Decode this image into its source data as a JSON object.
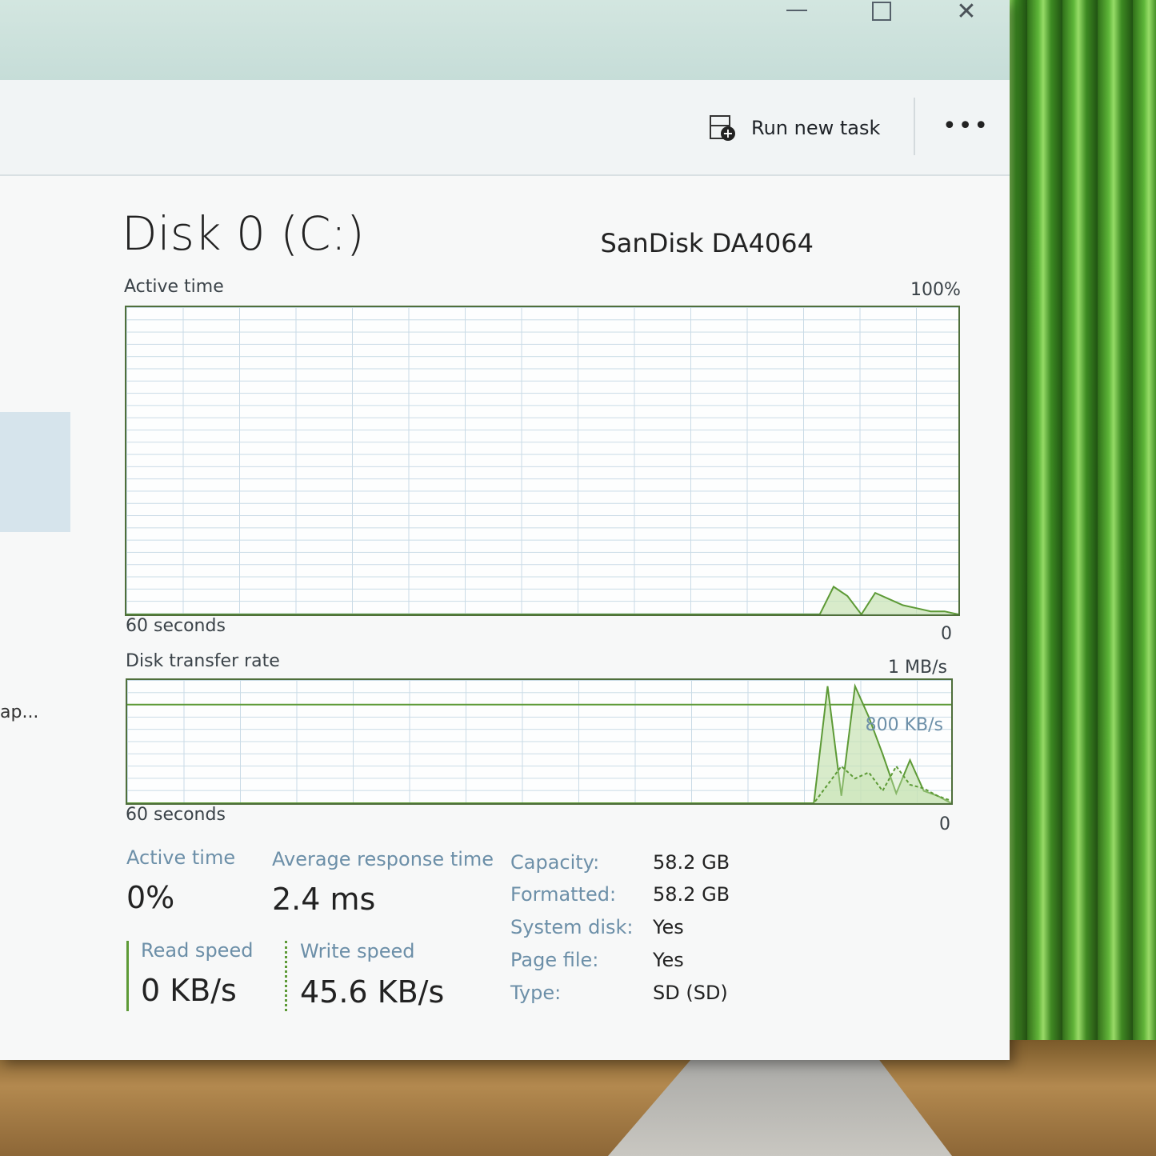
{
  "window": {
    "controls": {
      "minimize": "",
      "maximize": "",
      "close": "✕"
    }
  },
  "commandbar": {
    "run_new_task": "Run new task",
    "more": "•••"
  },
  "sidebar": {
    "truncated_item": "ap..."
  },
  "disk": {
    "title": "Disk 0 (C:)",
    "model": "SanDisk DA4064"
  },
  "active_time_graph": {
    "label": "Active time",
    "max": "100%",
    "time_span": "60 seconds",
    "min": "0"
  },
  "transfer_graph": {
    "label": "Disk transfer rate",
    "max": "1 MB/s",
    "reference": "800 KB/s",
    "time_span": "60 seconds",
    "min": "0"
  },
  "stats": {
    "active_time": {
      "label": "Active time",
      "value": "0%"
    },
    "avg_response": {
      "label": "Average response time",
      "value": "2.4 ms"
    },
    "read_speed": {
      "label": "Read speed",
      "value": "0 KB/s"
    },
    "write_speed": {
      "label": "Write speed",
      "value": "45.6 KB/s"
    }
  },
  "properties": [
    {
      "key": "Capacity:",
      "value": "58.2 GB"
    },
    {
      "key": "Formatted:",
      "value": "58.2 GB"
    },
    {
      "key": "System disk:",
      "value": "Yes"
    },
    {
      "key": "Page file:",
      "value": "Yes"
    },
    {
      "key": "Type:",
      "value": "SD (SD)"
    }
  ],
  "colors": {
    "graph_line": "#5d9a36",
    "graph_fill": "#c8e3b4",
    "label_blue": "#6c8fa8"
  },
  "chart_data": [
    {
      "type": "area",
      "ylim": [
        0,
        100
      ],
      "series": [
        {
          "values": [
            0,
            0,
            0,
            0,
            0,
            0,
            0,
            0,
            0,
            0,
            0,
            0,
            0,
            0,
            0,
            0,
            0,
            0,
            0,
            0,
            0,
            0,
            0,
            0,
            0,
            0,
            0,
            0,
            0,
            0,
            0,
            0,
            0,
            0,
            0,
            0,
            0,
            0,
            0,
            0,
            0,
            0,
            0,
            0,
            0,
            0,
            0,
            0,
            0,
            0,
            0,
            9,
            6,
            0,
            7,
            5,
            3,
            2,
            1,
            1,
            0
          ]
        }
      ]
    },
    {
      "type": "line",
      "ylim": [
        0,
        1000
      ],
      "series": [
        {
          "values": [
            0,
            0,
            0,
            0,
            0,
            0,
            0,
            0,
            0,
            0,
            0,
            0,
            0,
            0,
            0,
            0,
            0,
            0,
            0,
            0,
            0,
            0,
            0,
            0,
            0,
            0,
            0,
            0,
            0,
            0,
            0,
            0,
            0,
            0,
            0,
            0,
            0,
            0,
            0,
            0,
            0,
            0,
            0,
            0,
            0,
            0,
            0,
            0,
            0,
            0,
            0,
            950,
            60,
            950,
            700,
            400,
            80,
            350,
            100,
            60,
            0
          ]
        },
        {
          "values": [
            0,
            0,
            0,
            0,
            0,
            0,
            0,
            0,
            0,
            0,
            0,
            0,
            0,
            0,
            0,
            0,
            0,
            0,
            0,
            0,
            0,
            0,
            0,
            0,
            0,
            0,
            0,
            0,
            0,
            0,
            0,
            0,
            0,
            0,
            0,
            0,
            0,
            0,
            0,
            0,
            0,
            0,
            0,
            0,
            0,
            0,
            0,
            0,
            0,
            0,
            0,
            150,
            300,
            200,
            250,
            100,
            300,
            150,
            120,
            60,
            20
          ]
        }
      ]
    }
  ]
}
